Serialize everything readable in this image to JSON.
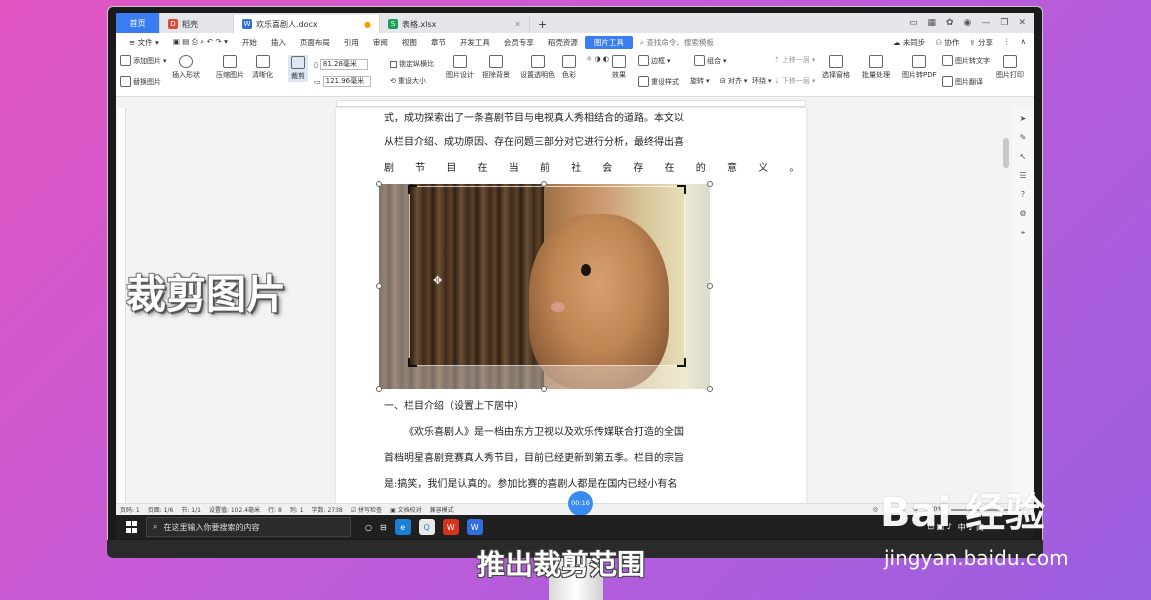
{
  "tabs": {
    "home": "首页",
    "straw": "稻壳",
    "doc": "欢乐喜剧人.docx",
    "sheet": "表格.xlsx"
  },
  "menu": {
    "file": "文件",
    "items": [
      "开始",
      "插入",
      "页面布局",
      "引用",
      "审阅",
      "视图",
      "章节",
      "开发工具",
      "会员专享",
      "稻壳资源"
    ],
    "picture_tools": "图片工具",
    "search": "查找命令、搜索模板",
    "sync": "未同步",
    "collab": "协作",
    "share": "分享"
  },
  "ribbon": {
    "add_picture": "添加图片",
    "replace_picture": "替换图片",
    "insert_shape": "插入形状",
    "compress": "压缩图片",
    "sharpen": "清晰化",
    "crop": "裁剪",
    "height": "81.28毫米",
    "width": "121.96毫米",
    "lock_ratio": "锁定纵横比",
    "reset_size": "重设大小",
    "picture_design": "图片设计",
    "remove_bg": "抠除背景",
    "transparent": "设置透明色",
    "color": "色彩",
    "effects": "效果",
    "border": "边框",
    "reset_style": "重设样式",
    "combine": "组合",
    "rotate": "旋转",
    "align": "对齐",
    "wrap": "环绕",
    "up_layer": "上移一层",
    "down_layer": "下移一层",
    "select_pane": "选择窗格",
    "batch": "批量处理",
    "to_pdf": "图片转PDF",
    "to_text": "图片转文字",
    "translate": "图片翻译",
    "print": "图片打印"
  },
  "document": {
    "line1": "式，成功探索出了一条喜剧节目与电视真人秀相结合的道路。本文以",
    "line2": "从栏目介绍、成功原因、存在问题三部分对它进行分析，最终得出喜",
    "line3": "剧 节 目 在 当 前 社 会 存 在 的 意 义 。",
    "heading": "一、栏目介绍（设置上下居中）",
    "body1": "《欢乐喜剧人》是一档由东方卫视以及欢乐传媒联合打造的全国",
    "body2": "首档明星喜剧竞赛真人秀节目，目前已经更新到第五季。栏目的宗旨",
    "body3": "是:搞笑，我们是认真的。参加比赛的喜剧人都是在国内已经小有名"
  },
  "status": {
    "page_num": "页码: 1",
    "pages": "页面: 1/6",
    "section": "节: 1/1",
    "position": "设置值: 102.4毫米",
    "row": "行: 8",
    "col": "列: 1",
    "words": "字数: 2738",
    "spell": "拼写检查",
    "proof": "文档校对",
    "compat": "兼容模式",
    "zoom": "100%"
  },
  "timer": "00:16",
  "taskbar": {
    "search": "在这里输入你要搜索的内容",
    "tray": "中 ♪ 简"
  },
  "overlay": {
    "title": "裁剪图片",
    "subtitle": "推出裁剪范围"
  },
  "watermark": {
    "logo": "Bai 经验",
    "url": "jingyan.baidu.com"
  }
}
